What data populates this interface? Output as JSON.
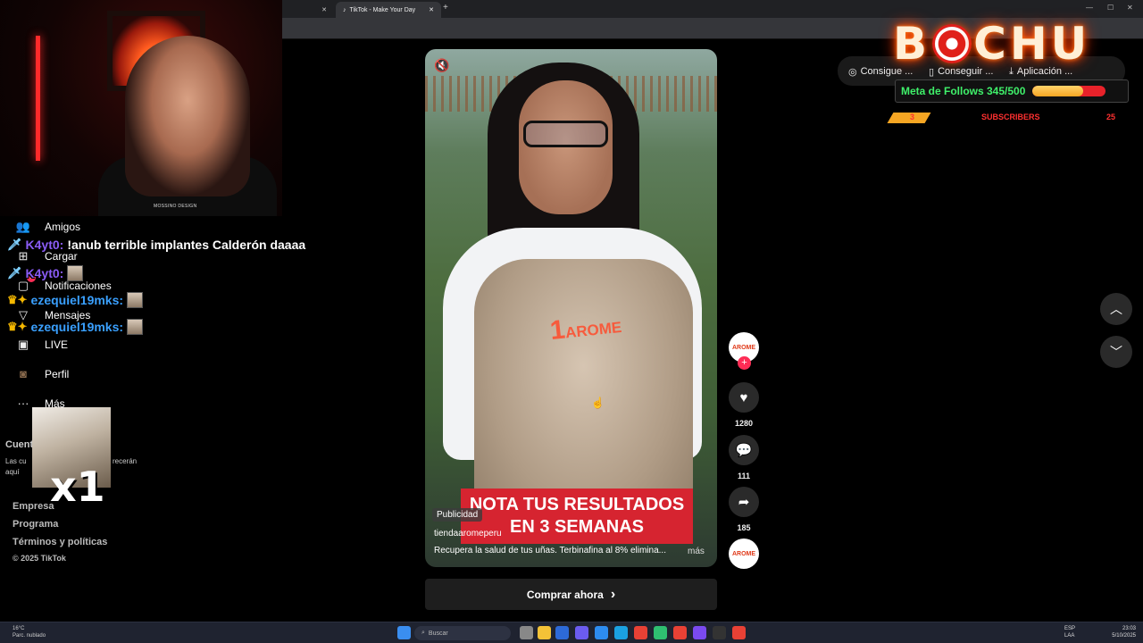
{
  "browser": {
    "tabs": [
      {
        "label": ""
      },
      {
        "label": "TikTok - Make Your Day"
      }
    ],
    "tab_close": "✕",
    "new_tab": "+",
    "window_controls": [
      "—",
      "☐",
      "✕"
    ]
  },
  "webcam": {
    "caption": "MOSSINO DESIGN"
  },
  "nav": {
    "items": [
      {
        "label": "Amigos",
        "icon": "friends-icon",
        "glyph": "👥"
      },
      {
        "label": "Cargar",
        "icon": "upload-icon",
        "glyph": "⊞"
      },
      {
        "label": "Notificaciones",
        "icon": "notifications-icon",
        "glyph": "▢",
        "badge": "1"
      },
      {
        "label": "Mensajes",
        "icon": "messages-icon",
        "glyph": "▽"
      },
      {
        "label": "LIVE",
        "icon": "live-icon",
        "glyph": "▣"
      },
      {
        "label": "Perfil",
        "icon": "profile-avatar-icon",
        "glyph": "◙"
      },
      {
        "label": "Más",
        "icon": "more-icon",
        "glyph": "···"
      }
    ],
    "accounts_heading": "Cuent",
    "accounts_text_left": "Las cu",
    "accounts_text_right": "recerán",
    "accounts_text_line2": "aquí"
  },
  "chat": [
    {
      "user": "K4yt0:",
      "message": "!anub terrible implantes Calderón daaaa",
      "user_color": "#8a5cf6"
    },
    {
      "user": "K4yt0:",
      "message": "",
      "user_color": "#8a5cf6"
    },
    {
      "user": "ezequiel19mks:",
      "message": "",
      "user_color": "#3aa0ff"
    },
    {
      "user": "ezequiel19mks:",
      "message": "",
      "user_color": "#3aa0ff"
    }
  ],
  "cat_overlay": {
    "multiplier": "x1"
  },
  "footer": {
    "links": [
      "Empresa",
      "Programa",
      "Términos y políticas"
    ],
    "copyright": "© 2025 TikTok"
  },
  "video": {
    "logo": "AROME",
    "logo_number": "1",
    "banner_line1": "NOTA TUS RESULTADOS",
    "banner_line2": "EN 3 SEMANAS",
    "sponsored_label": "Publicidad",
    "account": "tiendaaromeperu",
    "description": "Recupera la salud de tus uñas. Terbinafina al 8% elimina...",
    "more": "más"
  },
  "actions": {
    "avatar_text": "AROME",
    "likes": "1280",
    "comments": "111",
    "shares": "185"
  },
  "cta": {
    "label": "Comprar ahora",
    "chevron": "›"
  },
  "header_chips": [
    {
      "label": "Consigue ...",
      "icon": "coins-icon",
      "glyph": "◎"
    },
    {
      "label": "Conseguir ...",
      "icon": "phone-icon",
      "glyph": "▯"
    },
    {
      "label": "Aplicación ...",
      "icon": "download-icon",
      "glyph": "⤓"
    }
  ],
  "stream_overlay": {
    "logo_left": "B",
    "logo_right": "CHU",
    "follows_label": "Meta de Follows 345/500",
    "follows_progress": 0.69,
    "subs_count": "3",
    "subs_label": "SUBSCRIBERS",
    "subs_total": "25"
  },
  "taskbar": {
    "search_placeholder": "Buscar",
    "weather_temp": "16°C",
    "weather_desc": "Parc. nublado",
    "lang_line1": "ESP",
    "lang_line2": "LAA",
    "time": "23:03",
    "date": "5/10/2025"
  },
  "colors": {
    "accent_red": "#fe2c55",
    "follows_green": "#3ff06a",
    "banner_red": "#d62430"
  }
}
